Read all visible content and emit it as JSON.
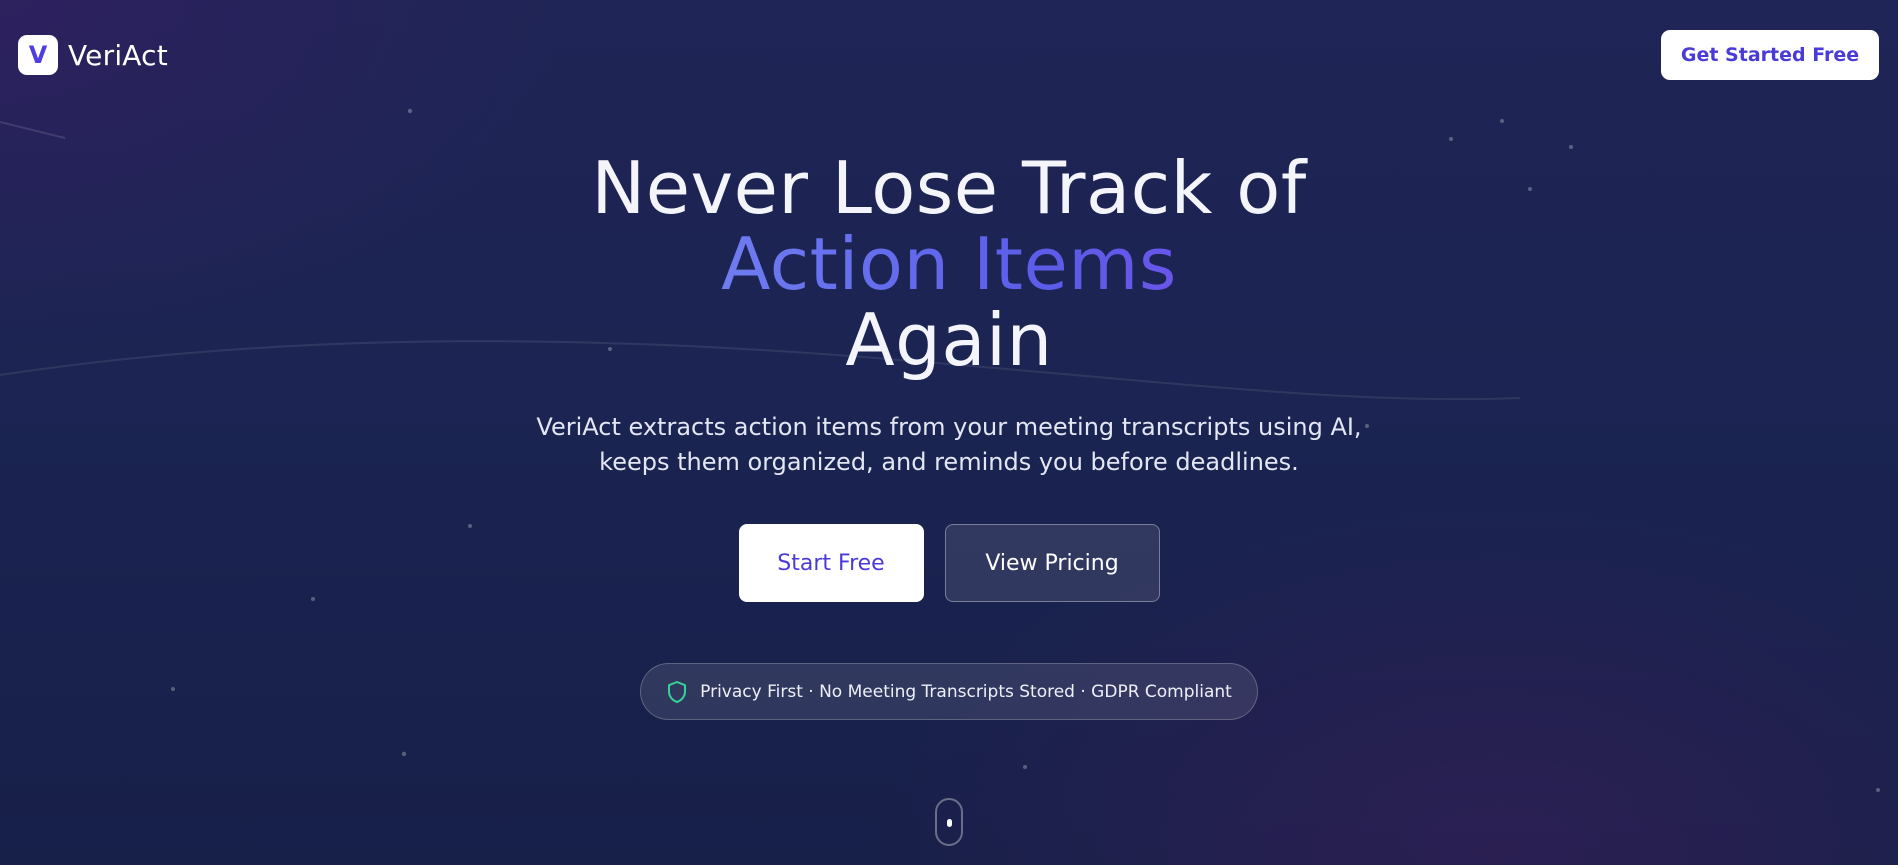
{
  "header": {
    "logo_letter": "V",
    "brand_name": "VeriAct",
    "cta_label": "Get Started Free"
  },
  "hero": {
    "title_line1": "Never Lose Track of",
    "title_highlight": "Action Items",
    "title_line3": "Again",
    "subtitle_line1": "VeriAct extracts action items from your meeting transcripts using AI,",
    "subtitle_line2": "keeps them organized, and reminds you before deadlines.",
    "primary_cta": "Start Free",
    "secondary_cta": "View Pricing"
  },
  "privacy_badge": {
    "icon": "shield-icon",
    "text": "Privacy First · No Meeting Transcripts Stored · GDPR Compliant"
  },
  "scroll_indicator": {
    "icon": "mouse-scroll-icon"
  },
  "colors": {
    "brand": "#4a3bd8",
    "background": "#1d2452",
    "shield": "#34d399",
    "gradient_start": "#b7c8ff",
    "gradient_end": "#b04be6"
  }
}
